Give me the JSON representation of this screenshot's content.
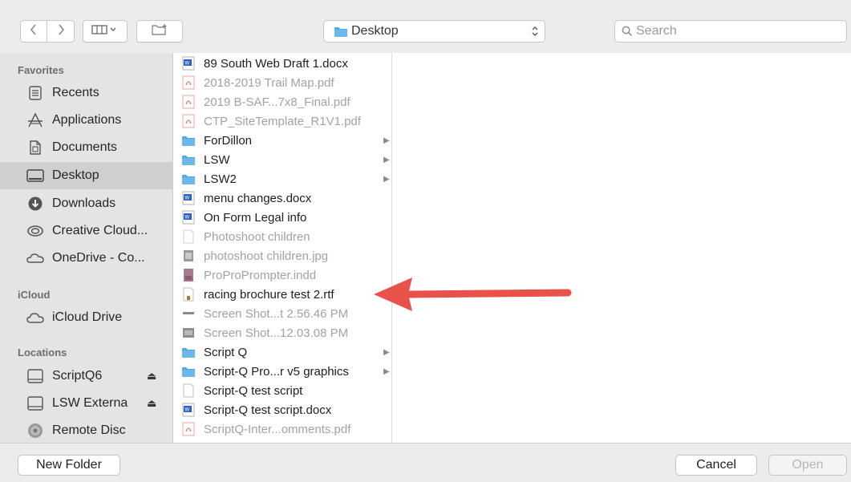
{
  "toolbar": {
    "back_icon": "chevron-left-icon",
    "forward_icon": "chevron-right-icon",
    "view_icon": "columns-view-icon",
    "new_folder_icon": "new-folder-icon",
    "location": "Desktop",
    "search_placeholder": "Search"
  },
  "sidebar": {
    "favorites_label": "Favorites",
    "favorites": [
      {
        "label": "Recents",
        "icon": "recents-icon"
      },
      {
        "label": "Applications",
        "icon": "applications-icon"
      },
      {
        "label": "Documents",
        "icon": "documents-icon"
      },
      {
        "label": "Desktop",
        "icon": "desktop-icon",
        "selected": true
      },
      {
        "label": "Downloads",
        "icon": "downloads-icon"
      },
      {
        "label": "Creative Cloud...",
        "icon": "creative-cloud-icon"
      },
      {
        "label": "OneDrive - Co...",
        "icon": "onedrive-icon"
      }
    ],
    "icloud_label": "iCloud",
    "icloud": [
      {
        "label": "iCloud Drive",
        "icon": "cloud-icon"
      }
    ],
    "locations_label": "Locations",
    "locations": [
      {
        "label": "ScriptQ6",
        "icon": "drive-icon",
        "eject": "⏏"
      },
      {
        "label": "LSW Externa",
        "icon": "drive-icon",
        "eject": "⏏"
      },
      {
        "label": "Remote Disc",
        "icon": "disc-icon"
      }
    ]
  },
  "files": [
    {
      "name": "89 South Web Draft 1.docx",
      "type": "docx",
      "enabled": true
    },
    {
      "name": "2018-2019 Trail Map.pdf",
      "type": "pdf",
      "enabled": false
    },
    {
      "name": "2019 B-SAF...7x8_Final.pdf",
      "type": "pdf",
      "enabled": false
    },
    {
      "name": "CTP_SiteTemplate_R1V1.pdf",
      "type": "pdf",
      "enabled": false
    },
    {
      "name": "ForDillon",
      "type": "folder",
      "enabled": true,
      "chevron": "▶"
    },
    {
      "name": "LSW",
      "type": "folder",
      "enabled": true,
      "chevron": "▶"
    },
    {
      "name": "LSW2",
      "type": "folder",
      "enabled": true,
      "chevron": "▶"
    },
    {
      "name": "menu changes.docx",
      "type": "docx",
      "enabled": true
    },
    {
      "name": "On Form Legal info",
      "type": "docx",
      "enabled": true
    },
    {
      "name": "Photoshoot children",
      "type": "blank",
      "enabled": false
    },
    {
      "name": "photoshoot children.jpg",
      "type": "image",
      "enabled": false
    },
    {
      "name": "ProProPrompter.indd",
      "type": "indd",
      "enabled": false
    },
    {
      "name": "racing brochure test 2.rtf",
      "type": "rtf",
      "enabled": true
    },
    {
      "name": "Screen Shot...t 2.56.46 PM",
      "type": "screenshot",
      "enabled": false
    },
    {
      "name": "Screen Shot...12.03.08 PM",
      "type": "image",
      "enabled": false
    },
    {
      "name": "Script Q",
      "type": "folder",
      "enabled": true,
      "chevron": "▶"
    },
    {
      "name": "Script-Q Pro...r v5 graphics",
      "type": "folder",
      "enabled": true,
      "chevron": "▶"
    },
    {
      "name": "Script-Q test script",
      "type": "blank",
      "enabled": true
    },
    {
      "name": "Script-Q test script.docx",
      "type": "docx",
      "enabled": true
    },
    {
      "name": "ScriptQ-Inter...omments.pdf",
      "type": "pdf",
      "enabled": false
    }
  ],
  "bottom": {
    "new_folder": "New Folder",
    "cancel": "Cancel",
    "open": "Open"
  },
  "colors": {
    "folder": "#4fa7e6",
    "arrow": "#e9524a",
    "selected": "#cfcfcf"
  }
}
